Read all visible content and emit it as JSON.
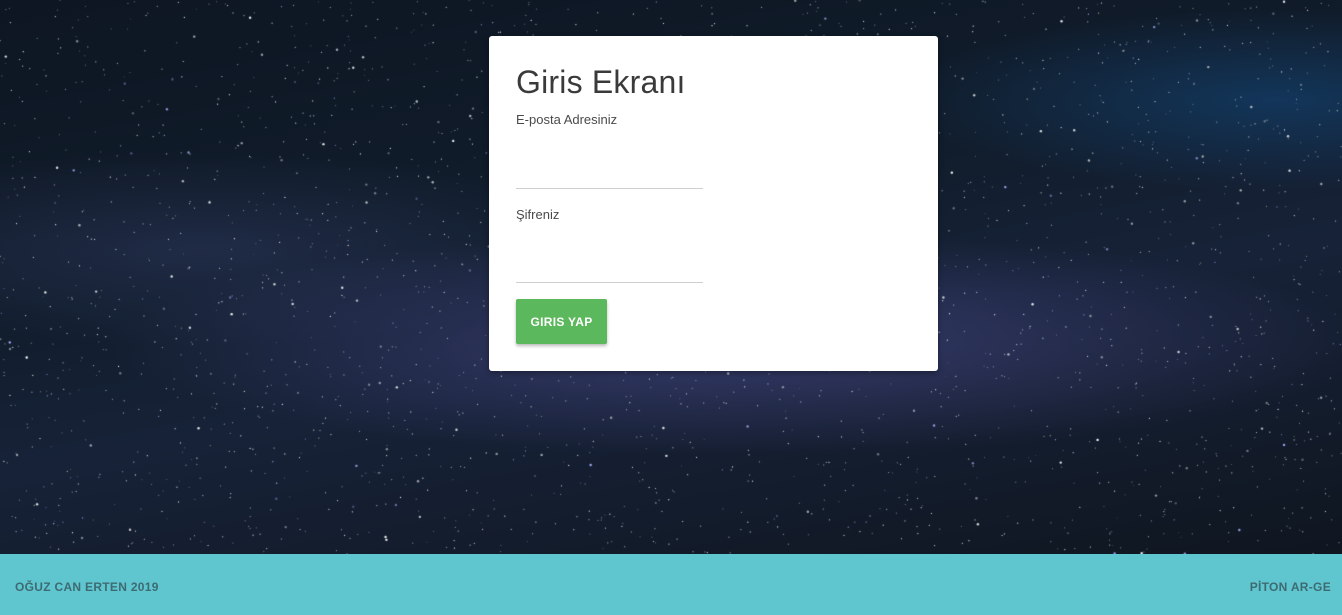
{
  "login": {
    "title": "Giris Ekranı",
    "email_label": "E-posta Adresiniz",
    "email_value": "",
    "password_label": "Şifreniz",
    "password_value": "",
    "submit_label": "GIRIS YAP"
  },
  "footer": {
    "left_text": "OĞUZ CAN ERTEN 2019",
    "right_text": "PİTON AR-GE"
  },
  "colors": {
    "button": "#5cb85c",
    "footer": "#5fc6d0",
    "background": "#111d2c"
  }
}
